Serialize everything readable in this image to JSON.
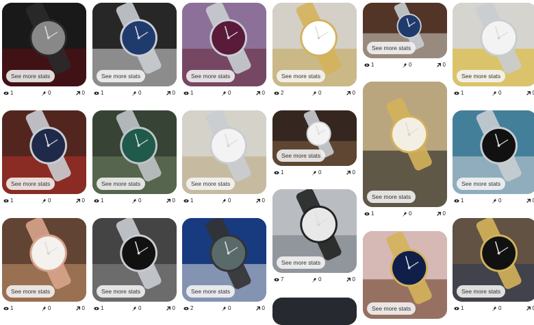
{
  "ui": {
    "see_more_label": "See more stats"
  },
  "colors": {
    "badge_bg": "#f2f2f2",
    "stat_text": "#222222"
  },
  "icons": {
    "views": "eye-icon",
    "saves": "pin-icon",
    "outbound": "arrow-up-right-icon"
  },
  "pins": [
    {
      "id": "c1r1",
      "views": "1",
      "saves": "0",
      "outbound": "0",
      "bg": "#1c1c1c",
      "accent": "#6b0f14",
      "watch": "#2a2a2a",
      "face": "#888888"
    },
    {
      "id": "c1r2",
      "views": "1",
      "saves": "0",
      "outbound": "0",
      "bg": "#5a2a22",
      "accent": "#c8342c",
      "watch": "#c9cdd2",
      "face": "#1f2a4a"
    },
    {
      "id": "c1r3",
      "views": "1",
      "saves": "0",
      "outbound": "0",
      "bg": "#6b4a3a",
      "accent": "#d9a373",
      "watch": "#d8a48b",
      "face": "#f4f1ee"
    },
    {
      "id": "c2r1",
      "views": "1",
      "saves": "0",
      "outbound": "0",
      "bg": "#2b2b2b",
      "accent": "#f3f3f3",
      "watch": "#c9cdd2",
      "face": "#1f3b6e"
    },
    {
      "id": "c2r2",
      "views": "1",
      "saves": "0",
      "outbound": "0",
      "bg": "#3c4a3a",
      "accent": "#7a8c6a",
      "watch": "#bfc3c7",
      "face": "#1f5a4a"
    },
    {
      "id": "c2r3",
      "views": "1",
      "saves": "0",
      "outbound": "0",
      "bg": "#4a4a4a",
      "accent": "#9a9a9a",
      "watch": "#c9cdd2",
      "face": "#111111"
    },
    {
      "id": "c3r1",
      "views": "1",
      "saves": "0",
      "outbound": "0",
      "bg": "#9a7aa8",
      "accent": "#6b2a3a",
      "watch": "#c9cdd2",
      "face": "#5a1a3a"
    },
    {
      "id": "c3r2",
      "views": "1",
      "saves": "0",
      "outbound": "0",
      "bg": "#e8e4dc",
      "accent": "#c9b68a",
      "watch": "#c9cdd2",
      "face": "#f3f3f3"
    },
    {
      "id": "c3r3",
      "views": "2",
      "saves": "0",
      "outbound": "0",
      "bg": "#1b3f8a",
      "accent": "#f0f0f0",
      "watch": "#333333",
      "face": "#5a6a6a"
    },
    {
      "id": "c4r1",
      "views": "2",
      "saves": "0",
      "outbound": "0",
      "bg": "#e6e2d8",
      "accent": "#d4b25a",
      "watch": "#d4b25a",
      "face": "#ffffff"
    },
    {
      "id": "c4r2",
      "views": "1",
      "saves": "0",
      "outbound": "0",
      "bg": "#3a2a22",
      "accent": "#8a6a4a",
      "watch": "#c9cdd2",
      "face": "#f3f3f3"
    },
    {
      "id": "c4r3",
      "views": "7",
      "saves": "0",
      "outbound": "0",
      "bg": "#c9ced3",
      "accent": "#7a8088",
      "watch": "#222222",
      "face": "#e8e8e8"
    },
    {
      "id": "c4r4",
      "bg": "#2a2d33",
      "accent": "#2a2d33",
      "watch": "#2a2d33",
      "face": "#2a2d33"
    },
    {
      "id": "c5r1",
      "views": "1",
      "saves": "0",
      "outbound": "0",
      "bg": "#5a3a2a",
      "accent": "#e8e2d8",
      "watch": "#c9cdd2",
      "face": "#1f3b6e"
    },
    {
      "id": "c5r2",
      "views": "1",
      "saves": "0",
      "outbound": "0",
      "bg": "#c9b58a",
      "accent": "#1a1a1a",
      "watch": "#d4b25a",
      "face": "#f3efe4"
    },
    {
      "id": "c5r3",
      "bg": "#e9c9c4",
      "accent": "#6a3a22",
      "watch": "#d4b25a",
      "face": "#0f1f4a"
    },
    {
      "id": "c6r1",
      "views": "1",
      "saves": "0",
      "outbound": "0",
      "bg": "#e8e6e0",
      "accent": "#f0c419",
      "watch": "#c9cdd2",
      "face": "#f3f3f3"
    },
    {
      "id": "c6r2",
      "views": "1",
      "saves": "0",
      "outbound": "0",
      "bg": "#4a8aa8",
      "accent": "#e0e6ea",
      "watch": "#c9cdd2",
      "face": "#111111"
    },
    {
      "id": "c6r3",
      "views": "1",
      "saves": "0",
      "outbound": "0",
      "bg": "#6a5a4a",
      "accent": "#2a3a5a",
      "watch": "#d4b25a",
      "face": "#111111"
    }
  ]
}
